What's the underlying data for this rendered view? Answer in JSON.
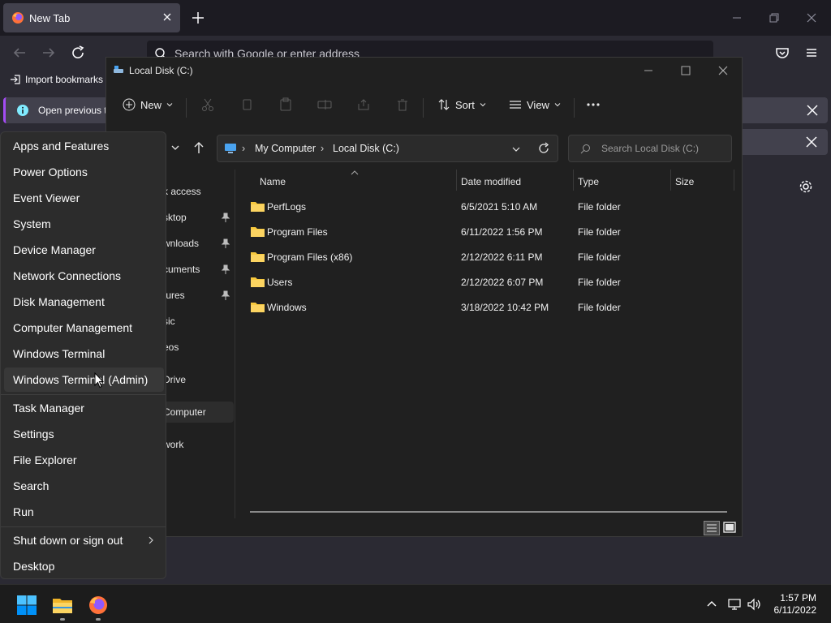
{
  "firefox": {
    "tab_title": "New Tab",
    "url_placeholder": "Search with Google or enter address",
    "bookmark_label": "Import bookmarks",
    "notice_text": "Open previous ta"
  },
  "explorer": {
    "window_title": "Local Disk (C:)",
    "toolbar": {
      "new_label": "New",
      "sort_label": "Sort",
      "view_label": "View"
    },
    "breadcrumb": [
      "My Computer",
      "Local Disk (C:)"
    ],
    "search_placeholder": "Search Local Disk (C:)",
    "nav_items": [
      {
        "label": "k access",
        "pinned": false
      },
      {
        "label": "sktop",
        "pinned": true
      },
      {
        "label": "wnloads",
        "pinned": true
      },
      {
        "label": "cuments",
        "pinned": true
      },
      {
        "label": "tures",
        "pinned": true
      },
      {
        "label": "sic",
        "pinned": false
      },
      {
        "label": "eos",
        "pinned": false
      },
      {
        "label": "Drive",
        "pinned": false
      },
      {
        "label": "Computer",
        "pinned": false
      },
      {
        "label": "work",
        "pinned": false
      }
    ],
    "columns": [
      "Name",
      "Date modified",
      "Type",
      "Size"
    ],
    "rows": [
      {
        "name": "PerfLogs",
        "date": "6/5/2021 5:10 AM",
        "type": "File folder",
        "size": ""
      },
      {
        "name": "Program Files",
        "date": "6/11/2022 1:56 PM",
        "type": "File folder",
        "size": ""
      },
      {
        "name": "Program Files (x86)",
        "date": "2/12/2022 6:11 PM",
        "type": "File folder",
        "size": ""
      },
      {
        "name": "Users",
        "date": "2/12/2022 6:07 PM",
        "type": "File folder",
        "size": ""
      },
      {
        "name": "Windows",
        "date": "3/18/2022 10:42 PM",
        "type": "File folder",
        "size": ""
      }
    ]
  },
  "winx_menu": {
    "group1": [
      "Apps and Features",
      "Power Options",
      "Event Viewer",
      "System",
      "Device Manager",
      "Network Connections",
      "Disk Management",
      "Computer Management",
      "Windows Terminal",
      "Windows Terminal (Admin)"
    ],
    "group2": [
      "Task Manager",
      "Settings",
      "File Explorer",
      "Search",
      "Run"
    ],
    "group3": [
      "Shut down or sign out",
      "Desktop"
    ],
    "hovered": "Windows Terminal (Admin)"
  },
  "taskbar": {
    "time": "1:57 PM",
    "date": "6/11/2022",
    "icons": [
      "windows-start-icon",
      "file-explorer-icon",
      "firefox-icon"
    ]
  },
  "colors": {
    "accent_blue": "#0078d4",
    "folder_yellow": "#f8c93e",
    "firefox_orange": "#ff7139",
    "notice_accent": "#a34cf4"
  }
}
